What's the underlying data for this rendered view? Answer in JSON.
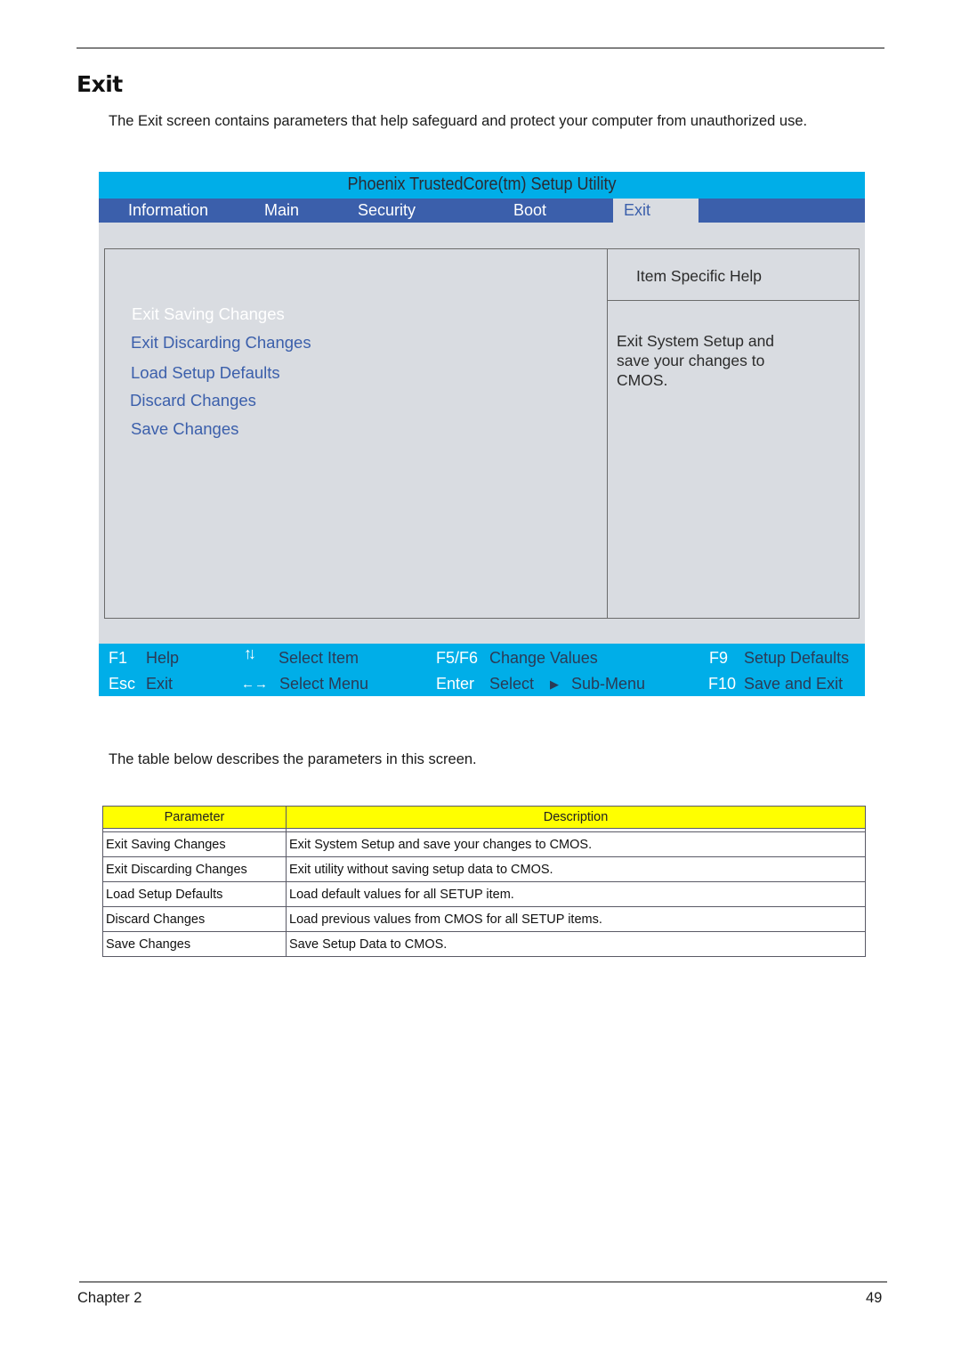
{
  "page": {
    "title": "Exit",
    "intro": "The Exit screen contains parameters that help safeguard and protect your computer from unauthorized use.",
    "table_intro": "The table below describes the parameters in this screen.",
    "footer_chapter": "Chapter 2",
    "footer_page": "49"
  },
  "bios": {
    "title": "Phoenix TrustedCore(tm) Setup Utility",
    "menu": [
      {
        "label": "Information",
        "active": false
      },
      {
        "label": "Main",
        "active": false
      },
      {
        "label": "Security",
        "active": false
      },
      {
        "label": "Boot",
        "active": false
      },
      {
        "label": "Exit",
        "active": true
      }
    ],
    "options": [
      {
        "label": "Exit Saving Changes",
        "selected": true
      },
      {
        "label": "Exit Discarding Changes",
        "selected": false
      },
      {
        "label": "Load Setup Defaults",
        "selected": false
      },
      {
        "label": "Discard Changes",
        "selected": false
      },
      {
        "label": "Save Changes",
        "selected": false
      }
    ],
    "help_header": "Item Specific Help",
    "help_lines": [
      "Exit System Setup and",
      "save your changes to",
      "CMOS."
    ],
    "footer": {
      "row1": [
        {
          "key": "F1",
          "desc": "Help"
        },
        {
          "key": "↑↓",
          "key_icon": "up-down-arrows-icon",
          "desc": "Select Item"
        },
        {
          "key": "F5/F6",
          "desc": "Change Values"
        },
        {
          "key": "F9",
          "desc": "Setup Defaults"
        }
      ],
      "row2": [
        {
          "key": "Esc",
          "desc": "Exit"
        },
        {
          "key": "←→",
          "key_icon": "left-right-arrows-icon",
          "desc": "Select Menu"
        },
        {
          "key": "Enter",
          "desc": "Select",
          "extra_icon": "triangle-right-icon",
          "extra_icon_glyph": "▶",
          "extra": "Sub-Menu"
        },
        {
          "key": "F10",
          "desc": "Save and Exit"
        }
      ]
    },
    "colors": {
      "title_bar": "#00aee8",
      "menu_bar": "#3b5fab",
      "panel_bg": "#d9dce1",
      "option_text": "#3b5fab",
      "selected_text": "#ffffff"
    }
  },
  "table": {
    "headers": [
      "Parameter",
      "Description"
    ],
    "header_color": "#ffff00",
    "rows": [
      [
        "Exit Saving Changes",
        "Exit System Setup and save your changes to CMOS."
      ],
      [
        "Exit Discarding Changes",
        "Exit utility without saving setup data to CMOS."
      ],
      [
        "Load Setup Defaults",
        "Load default values for all SETUP item."
      ],
      [
        "Discard Changes",
        "Load previous values from CMOS for all SETUP items."
      ],
      [
        "Save Changes",
        "Save Setup Data to CMOS."
      ]
    ]
  }
}
